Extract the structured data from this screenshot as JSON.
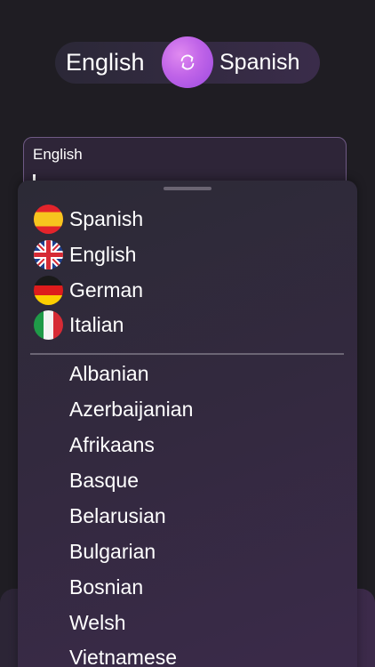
{
  "switcher": {
    "source_language": "English",
    "target_language": "Spanish",
    "swap_icon": "swap-arrows-icon"
  },
  "input_card": {
    "language_label": "English"
  },
  "dropdown": {
    "featured": [
      {
        "label": "Spanish",
        "flag": "spain-flag-icon"
      },
      {
        "label": "English",
        "flag": "uk-flag-icon"
      },
      {
        "label": "German",
        "flag": "germany-flag-icon"
      },
      {
        "label": "Italian",
        "flag": "italy-flag-icon"
      }
    ],
    "languages": [
      "Albanian",
      "Azerbaijanian",
      "Afrikaans",
      "Basque",
      "Belarusian",
      "Bulgarian",
      "Bosnian",
      "Welsh",
      "Vietnamese"
    ]
  },
  "colors": {
    "background": "#1f1d23",
    "accent": "#c064e8",
    "sheet": "#33293f"
  }
}
